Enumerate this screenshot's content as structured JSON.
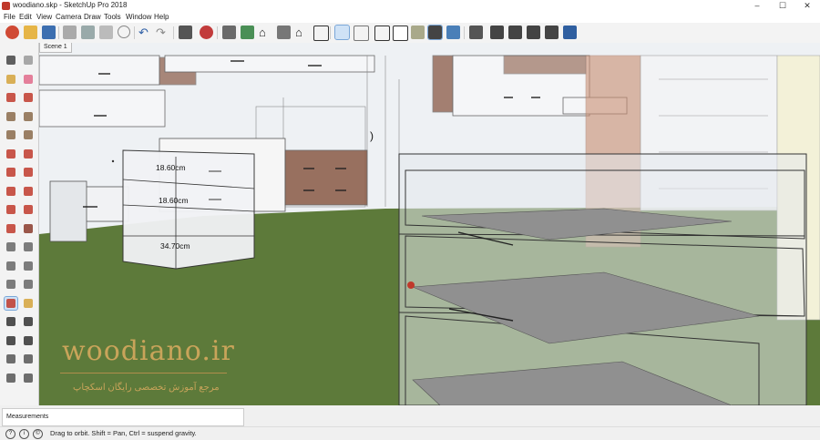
{
  "window": {
    "title": "woodiano.skp - SketchUp Pro 2018",
    "min": "–",
    "max": "☐",
    "close": "✕"
  },
  "menu": [
    "File",
    "Edit",
    "View",
    "Camera",
    "Draw",
    "Tools",
    "Window",
    "Help"
  ],
  "scene_tab": "Scene 1",
  "dimensions": [
    "18.60cm",
    "18.60cm",
    "34.70cm"
  ],
  "watermark": {
    "title": "woodiano.ir",
    "subtitle": "مرجع آموزش تخصصی رایگان اسکچاپ"
  },
  "measurements_label": "Measurements",
  "status": {
    "text": "Drag to orbit. Shift = Pan, Ctrl = suspend gravity.",
    "icons": [
      "?",
      "i",
      "©"
    ]
  },
  "colors": {
    "floor": "#5d7a3a",
    "wall": "#e9ecef",
    "wood": "#8a5a46",
    "accent": "#c9a45a",
    "selected": "#cfe2f6"
  },
  "toolbar_icons": [
    "getting-started-icon",
    "open-icon",
    "save-icon",
    "cut-icon",
    "copy-icon",
    "paste-icon",
    "erase-icon",
    "undo-icon",
    "redo-icon",
    "print-icon",
    "model-info-icon",
    "3d-warehouse-icon",
    "extension-warehouse-icon",
    "share-model-icon",
    "get-models-icon",
    "send-layout-icon",
    "xray-icon",
    "back-edges-icon",
    "wireframe-icon",
    "hidden-line-icon",
    "shaded-icon",
    "shaded-textures-icon",
    "monochrome-icon",
    "iso-view-icon",
    "top-view-icon",
    "front-view-icon",
    "right-view-icon",
    "back-view-icon",
    "left-view-icon"
  ],
  "left_tools": [
    "select-icon",
    "make-component-icon",
    "paint-bucket-icon",
    "eraser-icon",
    "line-icon",
    "freehand-icon",
    "rectangle-icon",
    "rotated-rect-icon",
    "circle-icon",
    "polygon-icon",
    "arc-icon",
    "pie-icon",
    "two-point-arc-icon",
    "three-point-arc-icon",
    "move-icon",
    "push-pull-icon",
    "rotate-icon",
    "follow-me-icon",
    "scale-icon",
    "offset-icon",
    "tape-measure-icon",
    "dimension-icon",
    "protractor-icon",
    "text-icon",
    "axes-icon",
    "3d-text-icon",
    "orbit-icon",
    "pan-icon",
    "zoom-icon",
    "zoom-window-icon",
    "zoom-extents-icon",
    "previous-view-icon",
    "position-camera-icon",
    "look-around-icon",
    "walk-icon",
    "section-plane-icon"
  ]
}
